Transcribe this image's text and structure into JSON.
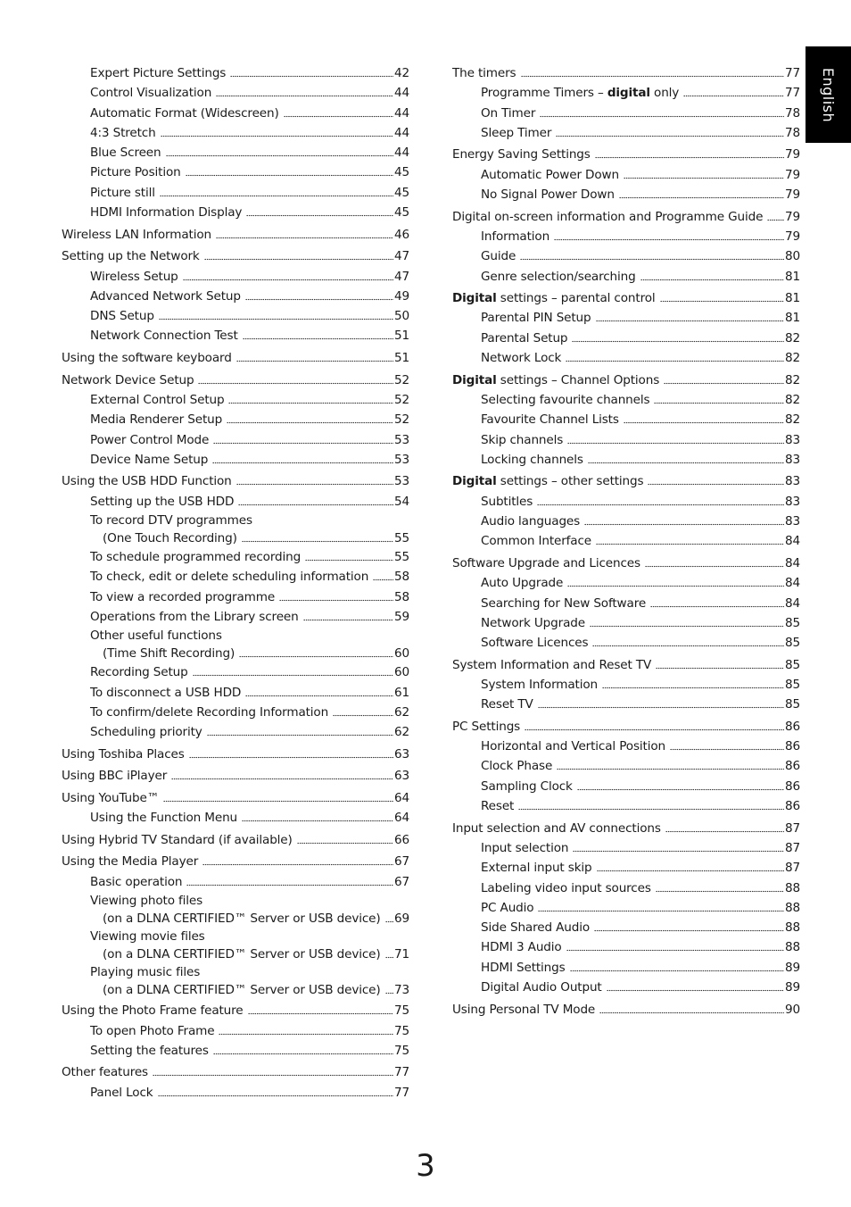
{
  "language_tab": "English",
  "page_number": "3",
  "left_column": [
    {
      "level": 1,
      "label": "Expert Picture Settings",
      "page": "42"
    },
    {
      "level": 1,
      "label": "Control Visualization",
      "page": "44"
    },
    {
      "level": 1,
      "label": "Automatic Format (Widescreen)",
      "page": "44"
    },
    {
      "level": 1,
      "label": "4:3 Stretch",
      "page": "44"
    },
    {
      "level": 1,
      "label": "Blue Screen",
      "page": "44"
    },
    {
      "level": 1,
      "label": "Picture Position",
      "page": "45"
    },
    {
      "level": 1,
      "label": "Picture still",
      "page": "45"
    },
    {
      "level": 1,
      "label": "HDMI Information Display",
      "page": "45"
    },
    {
      "level": 0,
      "label": "Wireless LAN Information",
      "page": "46"
    },
    {
      "level": 0,
      "label": "Setting up the Network",
      "page": "47"
    },
    {
      "level": 1,
      "label": "Wireless Setup",
      "page": "47"
    },
    {
      "level": 1,
      "label": "Advanced Network Setup",
      "page": "49"
    },
    {
      "level": 1,
      "label": "DNS Setup",
      "page": "50"
    },
    {
      "level": 1,
      "label": "Network Connection Test",
      "page": "51"
    },
    {
      "level": 0,
      "label": "Using the software keyboard",
      "page": "51"
    },
    {
      "level": 0,
      "label": "Network Device Setup",
      "page": "52"
    },
    {
      "level": 1,
      "label": "External Control Setup",
      "page": "52"
    },
    {
      "level": 1,
      "label": "Media Renderer Setup",
      "page": "52"
    },
    {
      "level": 1,
      "label": "Power Control Mode",
      "page": "53"
    },
    {
      "level": 1,
      "label": "Device Name Setup",
      "page": "53"
    },
    {
      "level": 0,
      "label": "Using the USB HDD Function",
      "page": "53"
    },
    {
      "level": 1,
      "label": "Setting up the USB HDD",
      "page": "54"
    },
    {
      "level": 1,
      "label": "To record DTV programmes",
      "continuation": "(One Touch Recording)",
      "page": "55"
    },
    {
      "level": 1,
      "label": "To schedule programmed recording",
      "page": "55"
    },
    {
      "level": 1,
      "label": "To check, edit or delete scheduling information",
      "page": "58"
    },
    {
      "level": 1,
      "label": "To view a recorded programme",
      "page": "58"
    },
    {
      "level": 1,
      "label": "Operations from the Library screen",
      "page": "59"
    },
    {
      "level": 1,
      "label": "Other useful functions",
      "continuation": "(Time Shift Recording)",
      "page": "60"
    },
    {
      "level": 1,
      "label": "Recording Setup",
      "page": "60"
    },
    {
      "level": 1,
      "label": "To disconnect a USB HDD",
      "page": "61"
    },
    {
      "level": 1,
      "label": "To confirm/delete Recording Information",
      "page": "62"
    },
    {
      "level": 1,
      "label": "Scheduling priority",
      "page": "62"
    },
    {
      "level": 0,
      "label": "Using Toshiba Places",
      "page": "63"
    },
    {
      "level": 0,
      "label": "Using BBC iPlayer",
      "page": "63"
    },
    {
      "level": 0,
      "label": "Using YouTube™",
      "page": "64"
    },
    {
      "level": 1,
      "label": "Using the Function Menu",
      "page": "64"
    },
    {
      "level": 0,
      "label": "Using Hybrid TV Standard (if available)",
      "page": "66"
    },
    {
      "level": 0,
      "label": "Using the Media Player",
      "page": "67"
    },
    {
      "level": 1,
      "label": "Basic operation",
      "page": "67"
    },
    {
      "level": 1,
      "label": "Viewing photo files",
      "continuation": "(on a DLNA CERTIFIED™ Server or USB device)",
      "page": "69"
    },
    {
      "level": 1,
      "label": "Viewing movie files",
      "continuation": "(on a DLNA CERTIFIED™ Server or USB device)",
      "page": "71"
    },
    {
      "level": 1,
      "label": "Playing music files",
      "continuation": "(on a DLNA CERTIFIED™ Server or USB device)",
      "page": "73"
    },
    {
      "level": 0,
      "label": "Using the Photo Frame feature",
      "page": "75"
    },
    {
      "level": 1,
      "label": "To open Photo Frame",
      "page": "75"
    },
    {
      "level": 1,
      "label": "Setting the features",
      "page": "75"
    },
    {
      "level": 0,
      "label": "Other features",
      "page": "77"
    },
    {
      "level": 1,
      "label": "Panel Lock",
      "page": "77"
    }
  ],
  "right_column": [
    {
      "level": 0,
      "label": "The timers",
      "page": "77"
    },
    {
      "level": 1,
      "label": "Programme Timers – ",
      "bold": "digital",
      "label_after": " only",
      "page": "77"
    },
    {
      "level": 1,
      "label": "On Timer",
      "page": "78"
    },
    {
      "level": 1,
      "label": "Sleep Timer",
      "page": "78"
    },
    {
      "level": 0,
      "label": "Energy Saving Settings",
      "page": "79"
    },
    {
      "level": 1,
      "label": "Automatic Power Down",
      "page": "79"
    },
    {
      "level": 1,
      "label": "No Signal Power Down",
      "page": "79"
    },
    {
      "level": 0,
      "label": "Digital on-screen information and Programme Guide",
      "page": "79"
    },
    {
      "level": 1,
      "label": "Information",
      "page": "79"
    },
    {
      "level": 1,
      "label": "Guide",
      "page": "80"
    },
    {
      "level": 1,
      "label": "Genre selection/searching",
      "page": "81"
    },
    {
      "level": 0,
      "bold": "Digital",
      "label_after": " settings – parental control",
      "page": "81"
    },
    {
      "level": 1,
      "label": "Parental PIN Setup",
      "page": "81"
    },
    {
      "level": 1,
      "label": "Parental Setup",
      "page": "82"
    },
    {
      "level": 1,
      "label": "Network Lock",
      "page": "82"
    },
    {
      "level": 0,
      "bold": "Digital",
      "label_after": " settings – Channel Options",
      "page": "82"
    },
    {
      "level": 1,
      "label": "Selecting favourite channels",
      "page": "82"
    },
    {
      "level": 1,
      "label": "Favourite Channel Lists",
      "page": "82"
    },
    {
      "level": 1,
      "label": "Skip channels",
      "page": "83"
    },
    {
      "level": 1,
      "label": "Locking channels",
      "page": "83"
    },
    {
      "level": 0,
      "bold": "Digital",
      "label_after": " settings – other settings",
      "page": "83"
    },
    {
      "level": 1,
      "label": "Subtitles",
      "page": "83"
    },
    {
      "level": 1,
      "label": "Audio languages",
      "page": "83"
    },
    {
      "level": 1,
      "label": "Common Interface",
      "page": "84"
    },
    {
      "level": 0,
      "label": "Software Upgrade and Licences",
      "page": "84"
    },
    {
      "level": 1,
      "label": "Auto Upgrade",
      "page": "84"
    },
    {
      "level": 1,
      "label": "Searching for New Software",
      "page": "84"
    },
    {
      "level": 1,
      "label": "Network Upgrade",
      "page": "85"
    },
    {
      "level": 1,
      "label": "Software Licences",
      "page": "85"
    },
    {
      "level": 0,
      "label": "System Information and Reset TV",
      "page": "85"
    },
    {
      "level": 1,
      "label": "System Information",
      "page": "85"
    },
    {
      "level": 1,
      "label": "Reset TV",
      "page": "85"
    },
    {
      "level": 0,
      "label": "PC Settings",
      "page": "86"
    },
    {
      "level": 1,
      "label": "Horizontal and Vertical Position",
      "page": "86"
    },
    {
      "level": 1,
      "label": "Clock Phase",
      "page": "86"
    },
    {
      "level": 1,
      "label": "Sampling Clock",
      "page": "86"
    },
    {
      "level": 1,
      "label": "Reset",
      "page": "86"
    },
    {
      "level": 0,
      "label": "Input selection and AV connections",
      "page": "87"
    },
    {
      "level": 1,
      "label": "Input selection",
      "page": "87"
    },
    {
      "level": 1,
      "label": "External input skip",
      "page": "87"
    },
    {
      "level": 1,
      "label": "Labeling video input sources",
      "page": "88"
    },
    {
      "level": 1,
      "label": "PC Audio",
      "page": "88"
    },
    {
      "level": 1,
      "label": "Side Shared Audio",
      "page": "88"
    },
    {
      "level": 1,
      "label": "HDMI 3 Audio",
      "page": "88"
    },
    {
      "level": 1,
      "label": "HDMI Settings",
      "page": "89"
    },
    {
      "level": 1,
      "label": "Digital Audio Output",
      "page": "89"
    },
    {
      "level": 0,
      "label": "Using Personal TV Mode",
      "page": "90"
    }
  ]
}
